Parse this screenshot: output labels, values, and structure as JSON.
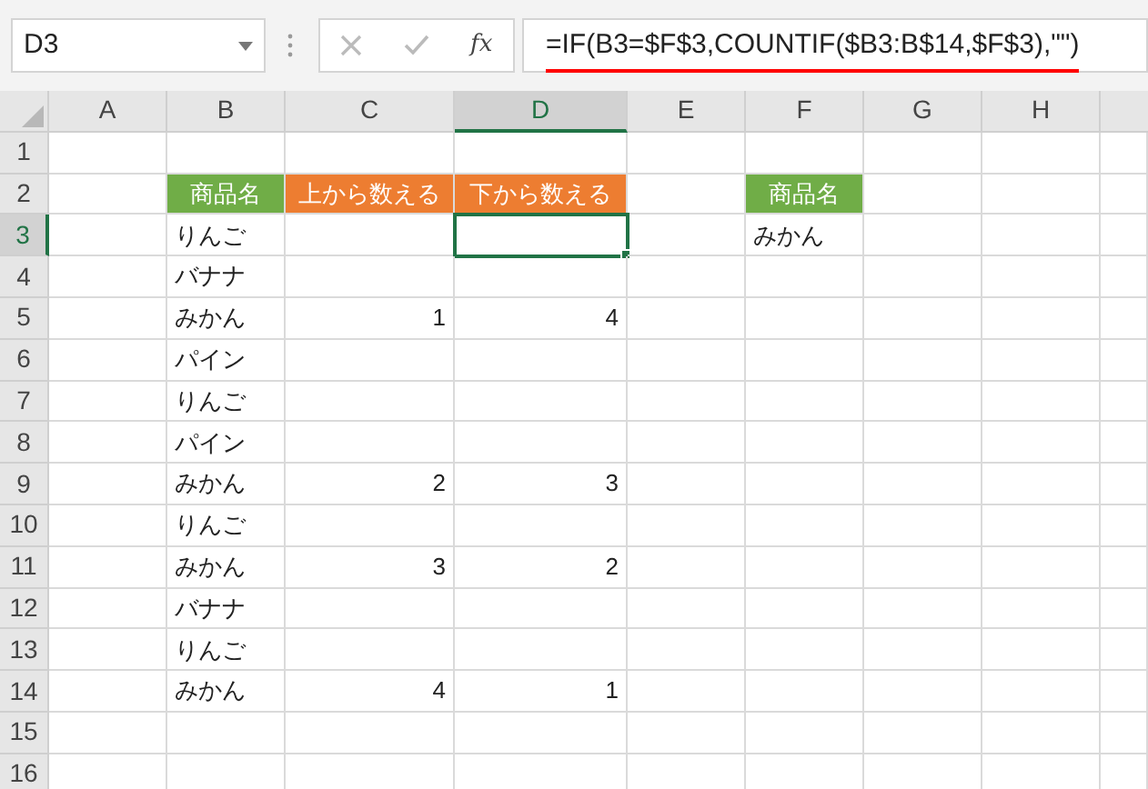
{
  "name_box": {
    "value": "D3"
  },
  "formula_bar": {
    "function_label": "fx",
    "formula": "=IF(B3=$F$3,COUNTIF($B3:B$14,$F$3),\"\")",
    "annotated": true
  },
  "columns": [
    {
      "label": "A",
      "selected": false
    },
    {
      "label": "B",
      "selected": false
    },
    {
      "label": "C",
      "selected": false
    },
    {
      "label": "D",
      "selected": true
    },
    {
      "label": "E",
      "selected": false
    },
    {
      "label": "F",
      "selected": false
    },
    {
      "label": "G",
      "selected": false
    },
    {
      "label": "H",
      "selected": false
    }
  ],
  "rows": [
    {
      "number": "1",
      "selected": false,
      "cells": {}
    },
    {
      "number": "2",
      "selected": false,
      "cells": {
        "B": {
          "kind": "header",
          "text": "商品名",
          "color": "#70ad47",
          "selected": false
        },
        "C": {
          "kind": "header",
          "text": "上から数える",
          "color": "#ed7d31",
          "selected": false
        },
        "D": {
          "kind": "header",
          "text": "下から数える",
          "color": "#ed7d31",
          "selected": false
        },
        "F": {
          "kind": "header",
          "text": "商品名",
          "color": "#70ad47",
          "selected": false
        }
      }
    },
    {
      "number": "3",
      "selected": true,
      "cells": {
        "B": {
          "kind": "text",
          "text": "りんご",
          "selected": false
        },
        "D": {
          "kind": "text",
          "selected": true
        },
        "F": {
          "kind": "text",
          "text": "みかん",
          "selected": false
        }
      }
    },
    {
      "number": "4",
      "selected": false,
      "cells": {
        "B": {
          "kind": "text",
          "text": "バナナ",
          "selected": false
        }
      }
    },
    {
      "number": "5",
      "selected": false,
      "cells": {
        "B": {
          "kind": "text",
          "text": "みかん",
          "selected": false
        },
        "C": {
          "kind": "number",
          "text": "1",
          "selected": false
        },
        "D": {
          "kind": "number",
          "text": "4",
          "selected": false
        }
      }
    },
    {
      "number": "6",
      "selected": false,
      "cells": {
        "B": {
          "kind": "text",
          "text": "パイン",
          "selected": false
        }
      }
    },
    {
      "number": "7",
      "selected": false,
      "cells": {
        "B": {
          "kind": "text",
          "text": "りんご",
          "selected": false
        }
      }
    },
    {
      "number": "8",
      "selected": false,
      "cells": {
        "B": {
          "kind": "text",
          "text": "パイン",
          "selected": false
        }
      }
    },
    {
      "number": "9",
      "selected": false,
      "cells": {
        "B": {
          "kind": "text",
          "text": "みかん",
          "selected": false
        },
        "C": {
          "kind": "number",
          "text": "2",
          "selected": false
        },
        "D": {
          "kind": "number",
          "text": "3",
          "selected": false
        }
      }
    },
    {
      "number": "10",
      "selected": false,
      "cells": {
        "B": {
          "kind": "text",
          "text": "りんご",
          "selected": false
        }
      }
    },
    {
      "number": "11",
      "selected": false,
      "cells": {
        "B": {
          "kind": "text",
          "text": "みかん",
          "selected": false
        },
        "C": {
          "kind": "number",
          "text": "3",
          "selected": false
        },
        "D": {
          "kind": "number",
          "text": "2",
          "selected": false
        }
      }
    },
    {
      "number": "12",
      "selected": false,
      "cells": {
        "B": {
          "kind": "text",
          "text": "バナナ",
          "selected": false
        }
      }
    },
    {
      "number": "13",
      "selected": false,
      "cells": {
        "B": {
          "kind": "text",
          "text": "りんご",
          "selected": false
        }
      }
    },
    {
      "number": "14",
      "selected": false,
      "cells": {
        "B": {
          "kind": "text",
          "text": "みかん",
          "selected": false
        },
        "C": {
          "kind": "number",
          "text": "4",
          "selected": false
        },
        "D": {
          "kind": "number",
          "text": "1",
          "selected": false
        }
      }
    },
    {
      "number": "15",
      "selected": false,
      "cells": {}
    },
    {
      "number": "16",
      "selected": false,
      "cells": {}
    }
  ]
}
